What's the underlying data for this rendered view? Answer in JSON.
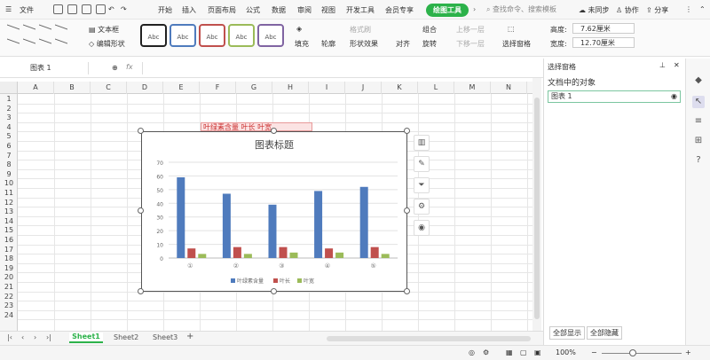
{
  "menubar": {
    "file": "文件",
    "tabs": [
      "开始",
      "插入",
      "页面布局",
      "公式",
      "数据",
      "审阅",
      "视图",
      "开发工具",
      "会员专享"
    ],
    "active_tab": "绘图工具",
    "search": "查找命令、搜索模板",
    "sync": "未同步",
    "collab": "协作",
    "share": "分享"
  },
  "ribbon": {
    "textbox": "文本框",
    "edit_shape": "编辑形状",
    "style_label": "Abc",
    "fill": "填充",
    "outline": "轮廓",
    "format_brush": "格式刷",
    "shape_effect": "形状效果",
    "align": "对齐",
    "group": "组合",
    "rotate": "旋转",
    "move_up": "上移一层",
    "move_down": "下移一层",
    "selection_pane": "选择窗格",
    "height_label": "高度:",
    "height_value": "7.62厘米",
    "width_label": "宽度:",
    "width_value": "12.70厘米"
  },
  "formula": {
    "name_box": "图表 1",
    "fx": "fx"
  },
  "grid": {
    "columns": [
      "A",
      "B",
      "C",
      "D",
      "E",
      "F",
      "G",
      "H",
      "I",
      "J",
      "K",
      "L",
      "M",
      "N"
    ],
    "rows": [
      "1",
      "2",
      "3",
      "4",
      "5",
      "6",
      "7",
      "8",
      "9",
      "10",
      "11",
      "12",
      "13",
      "14",
      "15",
      "16",
      "17",
      "18",
      "19",
      "20",
      "21",
      "22",
      "23",
      "24"
    ],
    "cell_row4": "叶绿素含量 叶长 叶宽"
  },
  "chart_data": {
    "type": "bar",
    "title": "图表标题",
    "categories": [
      "①",
      "②",
      "③",
      "④",
      "⑤"
    ],
    "series": [
      {
        "name": "叶绿素含量",
        "values": [
          59,
          47,
          39,
          49,
          52
        ]
      },
      {
        "name": "叶长",
        "values": [
          7,
          8,
          8,
          7,
          8
        ]
      },
      {
        "name": "叶宽",
        "values": [
          3,
          3,
          4,
          4,
          3
        ]
      }
    ],
    "colors": [
      "#4f7bbd",
      "#c0504d",
      "#9bbb59"
    ],
    "yticks": [
      "0",
      "10",
      "20",
      "30",
      "40",
      "50",
      "60",
      "70"
    ],
    "ylim": [
      0,
      70
    ],
    "legend": "bottom",
    "grid": true
  },
  "sheets": {
    "tabs": [
      "Sheet1",
      "Sheet2",
      "Sheet3"
    ],
    "active": "Sheet1"
  },
  "pane": {
    "title": "选择窗格",
    "subtitle": "文档中的对象",
    "item": "图表 1",
    "show_all": "全部显示",
    "hide_all": "全部隐藏"
  },
  "status": {
    "zoom": "100%"
  },
  "colors": {
    "accent": "#2cb24a",
    "chart_border": "#555555"
  }
}
